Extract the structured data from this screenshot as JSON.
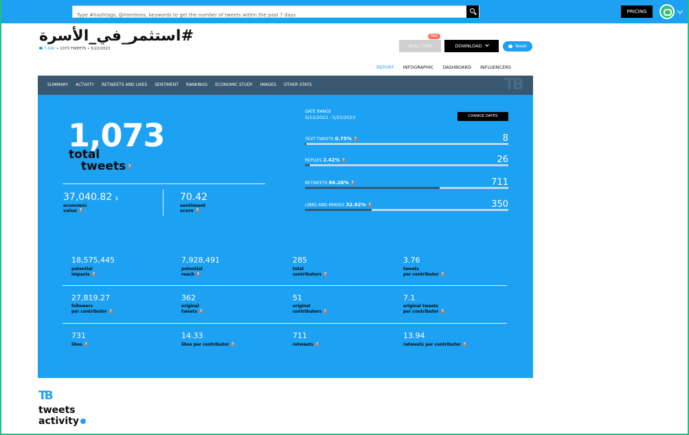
{
  "search": {
    "placeholder": "Type #hashtags, @mentions, keywords to get the number of tweets within the past 7 days"
  },
  "topbar": {
    "pricing_label": "PRICING"
  },
  "header": {
    "title": "#استثمر_في_الأسرة",
    "meta_range": "7-DAY",
    "meta_tweets": "1073 TWEETS",
    "meta_date": "5/22/2023",
    "pro_badge": "PRO",
    "realtime_label": "REAL TIME",
    "download_label": "DOWNLOAD",
    "tweet_label": "Tweet"
  },
  "view_tabs": [
    {
      "label": "REPORT",
      "active": true
    },
    {
      "label": "INFOGRAPHIC",
      "active": false
    },
    {
      "label": "DASHBOARD",
      "active": false
    },
    {
      "label": "INFLUENCERS",
      "active": false
    }
  ],
  "subnav": [
    "SUMMARY",
    "ACTIVITY",
    "RETWEETS AND LIKES",
    "SENTIMENT",
    "RANKINGS",
    "ECONOMIC STUDY",
    "IMAGES",
    "OTHER STATS"
  ],
  "logo_text": "TB",
  "summary": {
    "total_number": "1,073",
    "total_label_1": "total",
    "total_label_2": "tweets",
    "economic_value": "37,040.82",
    "economic_unit": "$",
    "economic_label_1": "economic",
    "economic_label_2": "value",
    "sentiment_value": "70.42",
    "sentiment_label_1": "sentiment",
    "sentiment_label_2": "score",
    "date_range_label": "DATE RANGE",
    "date_range_value": "5/12/2023 - 5/22/2023",
    "change_dates_label": "CHANGE DATES"
  },
  "stats": [
    {
      "label": "TEXT TWEETS",
      "pct": "0.75%",
      "value": "8",
      "fraction": 0.0075
    },
    {
      "label": "REPLIES",
      "pct": "2.42%",
      "value": "26",
      "fraction": 0.0242
    },
    {
      "label": "RETWEETS",
      "pct": "66.26%",
      "value": "711",
      "fraction": 0.6626
    },
    {
      "label": "LINKS AND IMAGES",
      "pct": "32.62%",
      "value": "350",
      "fraction": 0.3262
    }
  ],
  "grid": [
    [
      {
        "value": "18,575,445",
        "label_1": "potential",
        "label_2": "impacts"
      },
      {
        "value": "7,928,491",
        "label_1": "potential",
        "label_2": "reach"
      },
      {
        "value": "285",
        "label_1": "total",
        "label_2": "contributors"
      },
      {
        "value": "3.76",
        "label_1": "tweets",
        "label_2": "per contributor"
      }
    ],
    [
      {
        "value": "27,819.27",
        "label_1": "followers",
        "label_2": "per contributor"
      },
      {
        "value": "362",
        "label_1": "original",
        "label_2": "tweets"
      },
      {
        "value": "51",
        "label_1": "original",
        "label_2": "contributors"
      },
      {
        "value": "7.1",
        "label_1": "original tweets",
        "label_2": "per contributor"
      }
    ],
    [
      {
        "value": "731",
        "label_1": "likes",
        "label_2": ""
      },
      {
        "value": "14.33",
        "label_1": "likes per contributor",
        "label_2": ""
      },
      {
        "value": "711",
        "label_1": "retweets",
        "label_2": ""
      },
      {
        "value": "13.94",
        "label_1": "retweets per contributor",
        "label_2": ""
      }
    ]
  ],
  "activity": {
    "logo": "TB",
    "title_1": "tweets",
    "title_2": "activity"
  }
}
